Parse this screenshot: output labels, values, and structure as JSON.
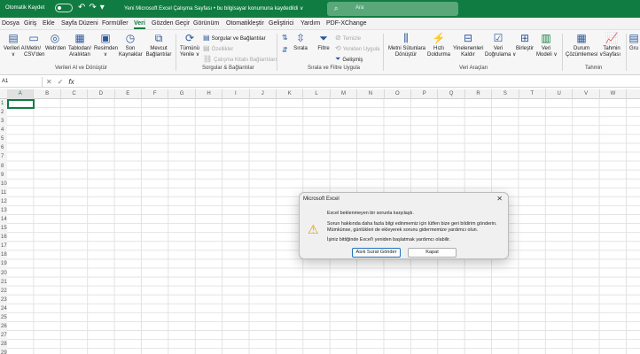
{
  "titlebar": {
    "autosave_label": "Otomatik Kaydet",
    "toggle_state": "Kapalı",
    "qat_icons": [
      "save-icon",
      "undo-icon",
      "redo-icon",
      "customize-qat-icon"
    ],
    "doc_title": "Yeni Microsoft Excel Çalışma Sayfası  •  bu bilgisayar konumuna kaydedildi  ∨",
    "search_placeholder": "Ara"
  },
  "menu": {
    "items": [
      "Dosya",
      "Giriş",
      "Ekle",
      "Sayfa Düzeni",
      "Formüller",
      "Veri",
      "Gözden Geçir",
      "Görünüm",
      "Otomatikleştir",
      "Geliştirici",
      "Yardım",
      "PDF-XChange"
    ],
    "active": "Veri"
  },
  "ribbon": {
    "get_data": {
      "label": "Verileri Al",
      "caret": "∨"
    },
    "text_csv": {
      "line1": "Metin/",
      "line2": "CSV'den"
    },
    "from_web": "Web'den",
    "table_range": {
      "line1": "Tablodan/",
      "line2": "Aralıktan"
    },
    "from_picture": {
      "label": "Resimden",
      "caret": "∨"
    },
    "recent_sources": {
      "line1": "Son",
      "line2": "Kaynaklar"
    },
    "existing_conn": {
      "line1": "Mevcut",
      "line2": "Bağlantılar"
    },
    "group_get": "Verileri Al ve Dönüştür",
    "refresh_all": {
      "line1": "Tümünü",
      "line2": "Yenile ∨"
    },
    "queries_conn": "Sorgular ve Bağlantılar",
    "properties": "Özellikler",
    "workbook_links": "Çalışma Kitabı Bağlantıları",
    "group_queries": "Sorgular & Bağlantılar",
    "sort": "Sırala",
    "filter": "Filtre",
    "clear": "Temizle",
    "reapply": "Yeniden Uygula",
    "advanced": "Gelişmiş",
    "group_sort": "Sırala ve Filtre Uygula",
    "text_to_columns": {
      "line1": "Metni Sütunlara",
      "line2": "Dönüştür"
    },
    "flash_fill": {
      "line1": "Hızlı",
      "line2": "Doldurma"
    },
    "remove_dupes": {
      "line1": "Yinelenenleri",
      "line2": "Kaldır"
    },
    "data_validation": {
      "line1": "Veri",
      "line2": "Doğrulama ∨"
    },
    "consolidate": "Birleştir",
    "data_model": {
      "line1": "Veri",
      "line2": "Modeli ∨"
    },
    "group_tools": "Veri Araçları",
    "what_if": {
      "line1": "Durum",
      "line2": "Çözümlemesi ∨"
    },
    "forecast": {
      "line1": "Tahmin",
      "line2": "Sayfası"
    },
    "group_forecast": "Tahmin",
    "outline": "Gru"
  },
  "formula_bar": {
    "name_box": "A1",
    "formula": ""
  },
  "grid": {
    "columns": [
      "A",
      "B",
      "C",
      "D",
      "E",
      "F",
      "G",
      "H",
      "I",
      "J",
      "K",
      "L",
      "M",
      "N",
      "O",
      "P",
      "Q",
      "R",
      "S",
      "T",
      "U",
      "V",
      "W"
    ],
    "rows": [
      "1",
      "2",
      "3",
      "4",
      "5",
      "6",
      "7",
      "8",
      "9",
      "10",
      "11",
      "12",
      "13",
      "14",
      "15",
      "16",
      "17",
      "18",
      "19",
      "20",
      "21",
      "22",
      "23",
      "24",
      "25",
      "26",
      "27",
      "28",
      "29"
    ],
    "selected": "A1"
  },
  "dialog": {
    "title": "Microsoft Excel",
    "line1": "Excel beklenmeyen bir sorunla karşılaştı.",
    "line2": "Sorun hakkında daha fazla bilgi edinmemiz için lütfen bize geri bildirim gönderin.",
    "line3": "Mümkünse, günlükleri de ekleyerek sorunu gidermemize yardımcı olun.",
    "line4": "İşiniz bittiğinde Excel'i yeniden başlatmak yardımcı olabilir.",
    "send_button": "Asık Surat Gönder",
    "close_button": "Kapat"
  }
}
